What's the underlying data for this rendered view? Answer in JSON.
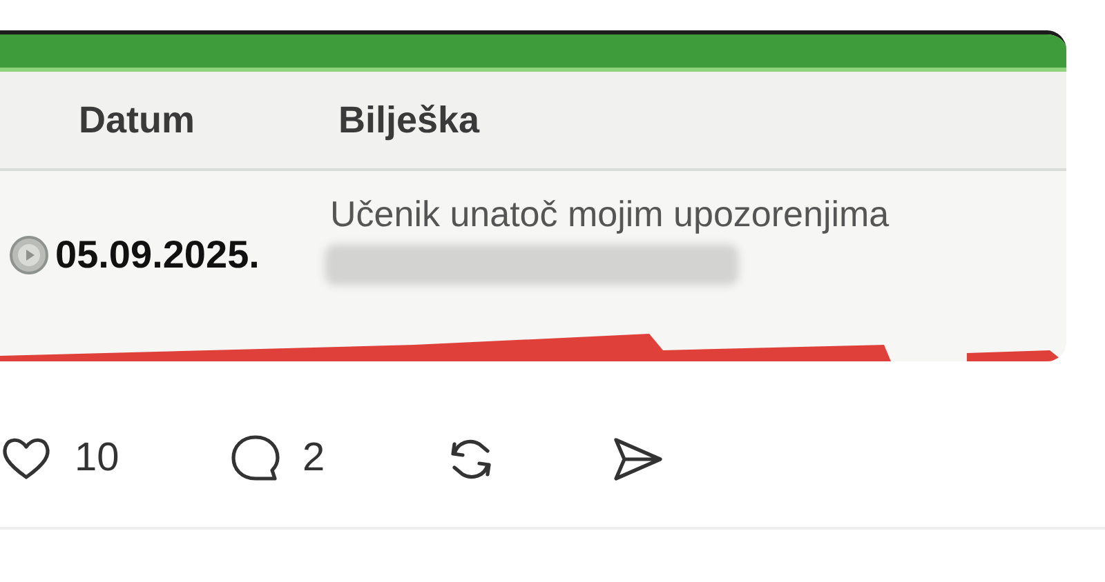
{
  "post": {
    "image": {
      "table": {
        "columns": [
          "Datum",
          "Bilješka"
        ],
        "rows": [
          {
            "date": "05.09.2025.",
            "note": "Učenik unatoč mojim upozorenjima"
          }
        ]
      }
    },
    "actions": [
      {
        "kind": "like",
        "count": "10"
      },
      {
        "kind": "comment",
        "count": "2"
      },
      {
        "kind": "repost"
      },
      {
        "kind": "share"
      }
    ]
  }
}
